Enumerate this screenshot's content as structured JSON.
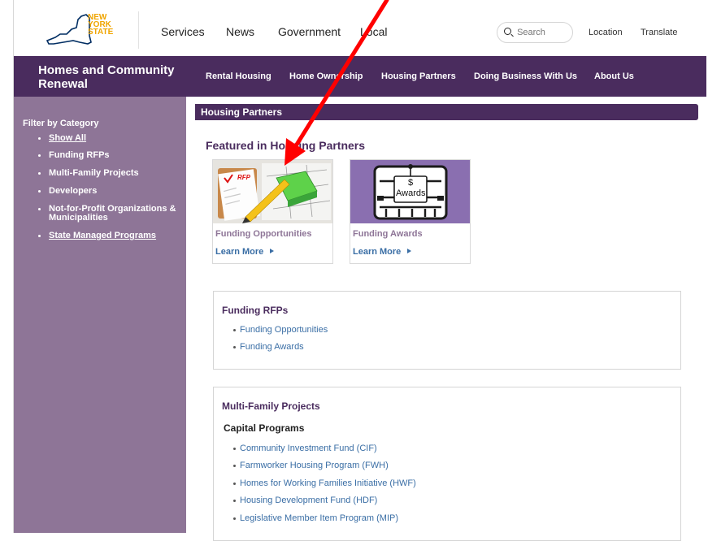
{
  "header": {
    "logo": {
      "line1": "NEW",
      "line2": "YORK",
      "line3": "STATE"
    },
    "nav": [
      "Services",
      "News",
      "Government",
      "Local"
    ],
    "search": {
      "label": "Search"
    },
    "location": "Location",
    "translate": "Translate"
  },
  "agency": {
    "name_line1": "Homes and Community",
    "name_line2": "Renewal",
    "nav": [
      "Rental Housing",
      "Home Ownership",
      "Housing Partners",
      "Doing Business With Us",
      "About Us"
    ]
  },
  "sidebar": {
    "title": "Filter by Category",
    "items": [
      {
        "label": "Show All"
      },
      {
        "label": "Funding RFPs"
      },
      {
        "label": "Multi-Family Projects"
      },
      {
        "label": "Developers"
      },
      {
        "label": "Not-for-Profit Organizations & Municipalities"
      },
      {
        "label": "State Managed Programs"
      }
    ]
  },
  "main": {
    "section_title": "Housing Partners",
    "featured_title": "Featured in Housing Partners",
    "cards": [
      {
        "title": "Funding Opportunities",
        "link": "Learn More",
        "image_text": "RFP"
      },
      {
        "title": "Funding Awards",
        "link": "Learn More",
        "image_text_1": "$",
        "image_text_2": "Awards"
      }
    ],
    "funding_rfps": {
      "title": "Funding RFPs",
      "links": [
        "Funding Opportunities",
        "Funding Awards"
      ]
    },
    "multi_family": {
      "title": "Multi-Family Projects",
      "subtitle": "Capital Programs",
      "links": [
        "Community Investment Fund (CIF)",
        "Farmworker Housing Program (FWH)",
        "Homes for Working Families Initiative (HWF)",
        "Housing Development Fund (HDF)",
        "Legislative Member Item Program (MIP)"
      ]
    }
  },
  "colors": {
    "brand_purple": "#4a2c5e",
    "sidebar_purple": "#8e7597",
    "link_blue": "#3a6ea5",
    "logo_gold": "#f0a500",
    "logo_navy": "#002d62",
    "annotation_red": "#ff0000"
  }
}
